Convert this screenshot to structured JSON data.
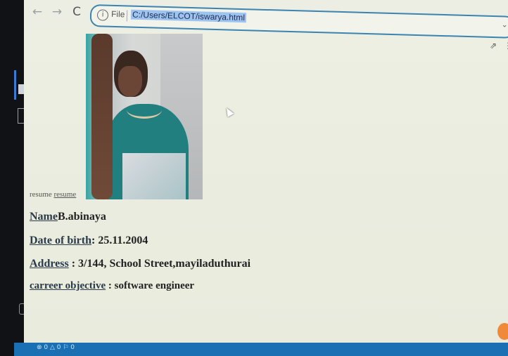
{
  "browser": {
    "back_icon": "←",
    "forward_icon": "→",
    "reload_icon": "C",
    "scheme": "File",
    "url": "C:/Users/ELCOT/iswarya.html",
    "dropdown_icon": "⌄"
  },
  "page": {
    "image_alt": "resume",
    "image_link": "resume",
    "name_label": "Name",
    "name_value": "B.abinaya",
    "dob_label": "Date of birth",
    "dob_value": ": 25.11.2004",
    "address_label": "Address",
    "address_value": " : 3/144, School Street,mayiladuthurai",
    "objective_label": "carreer objective",
    "objective_value": " : software engineer"
  },
  "taskbar": {
    "status": "⊗ 0 △ 0   ⚐ 0"
  },
  "colors": {
    "address_bar_border": "#3c83b0",
    "selection": "#9cc4ee",
    "taskbar": "#1b6fb3"
  }
}
